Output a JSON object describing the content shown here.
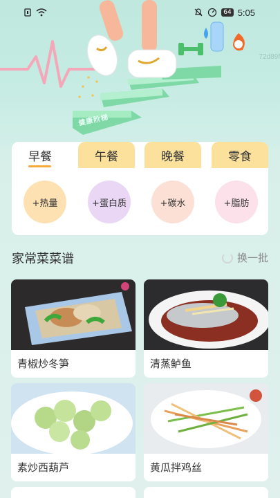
{
  "status_bar": {
    "time": "5:05",
    "battery": "64"
  },
  "hero": {
    "code": "72d89f",
    "step_label": "健康阶梯"
  },
  "meal_tabs": [
    {
      "label": "早餐",
      "active": true
    },
    {
      "label": "午餐",
      "active": false
    },
    {
      "label": "晚餐",
      "active": false
    },
    {
      "label": "零食",
      "active": false
    }
  ],
  "nutrients": [
    {
      "label": "+热量",
      "color": "#fde1b2"
    },
    {
      "label": "+蛋白质",
      "color": "#ead7f6"
    },
    {
      "label": "+碳水",
      "color": "#fde0d5"
    },
    {
      "label": "+脂肪",
      "color": "#fce1ea"
    }
  ],
  "recipes_section": {
    "title": "家常菜菜谱",
    "refresh_label": "换一批"
  },
  "recipes": [
    {
      "name": "青椒炒冬笋",
      "icon": "green-pepper-bamboo-shoots-dish"
    },
    {
      "name": "清蒸鲈鱼",
      "icon": "steamed-fish-dish"
    },
    {
      "name": "素炒西葫芦",
      "icon": "zucchini-dish"
    },
    {
      "name": "黄瓜拌鸡丝",
      "icon": "chicken-cucumber-dish"
    }
  ],
  "colors": {
    "accent": "#f7a93b",
    "tab_inactive": "#fbe19b",
    "background": "#d7efe9"
  }
}
